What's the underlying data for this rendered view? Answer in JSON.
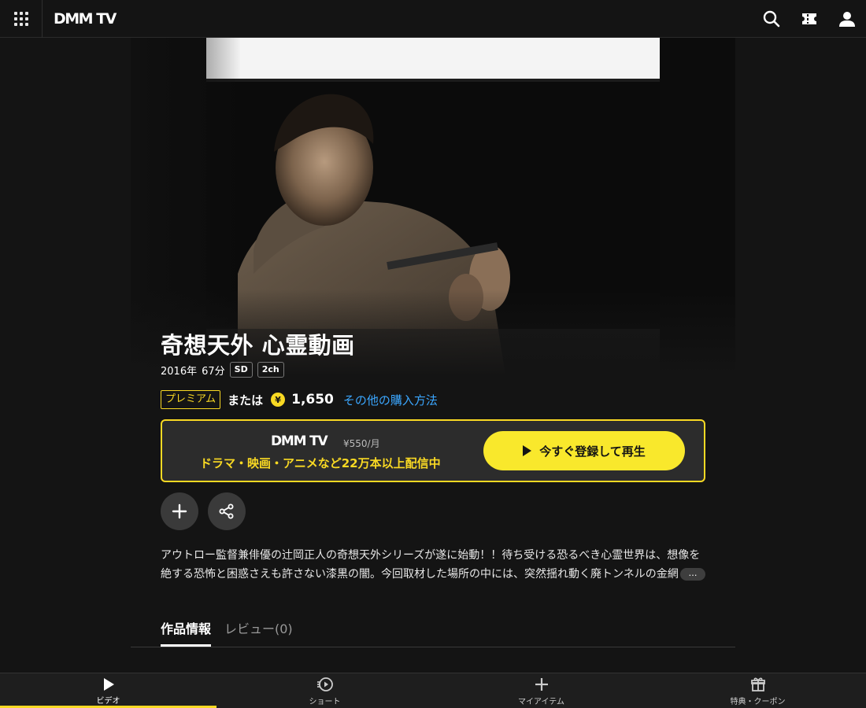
{
  "header": {
    "logo": "DMM TV",
    "icons": [
      "menu-grid-icon",
      "search-icon",
      "ticket-icon",
      "user-icon"
    ]
  },
  "content": {
    "title": "奇想天外 心霊動画",
    "year": "2016年",
    "duration": "67分",
    "quality_badge": "SD",
    "audio_badge": "2ch",
    "premium_label": "プレミアム",
    "or_text": "または",
    "price": "1,650",
    "other_purchase_link": "その他の購入方法",
    "description": "アウトロー監督兼俳優の辻岡正人の奇想天外シリーズが遂に始動！！待ち受ける恐るべき心霊世界は、想像を絶する恐怖と困惑さえも許さない漆黒の闇。今回取材した場所の中には、突然揺れ動く廃トンネルの金網",
    "more_button": "…"
  },
  "promo": {
    "logo": "DMM TV",
    "price": "¥550/月",
    "copy": "ドラマ・映画・アニメなど22万本以上配信中",
    "button_label": "今すぐ登録して再生"
  },
  "tabs": [
    {
      "label": "作品情報",
      "active": true
    },
    {
      "label": "レビュー(0)",
      "active": false
    }
  ],
  "bottom_nav": [
    {
      "label": "ビデオ",
      "icon": "play-icon",
      "active": true
    },
    {
      "label": "ショート",
      "icon": "shorts-icon",
      "active": false
    },
    {
      "label": "マイアイテム",
      "icon": "plus-icon",
      "active": false
    },
    {
      "label": "特典・クーポン",
      "icon": "gift-icon",
      "active": false
    }
  ],
  "colors": {
    "accent": "#f9d923",
    "button_yellow": "#f9e82c",
    "link": "#3ba7ff",
    "background": "#141414"
  }
}
